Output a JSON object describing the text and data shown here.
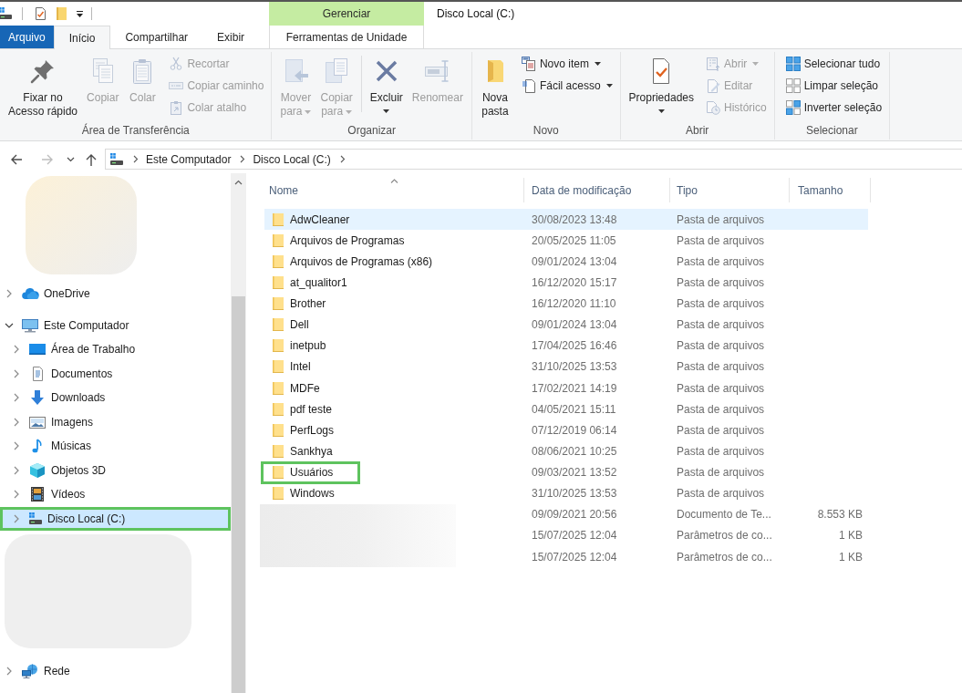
{
  "window": {
    "title": "Disco Local (C:)"
  },
  "ribbon": {
    "contextual_header": "Gerenciar",
    "tabs": [
      {
        "label": "Arquivo",
        "kind": "file",
        "selected": false
      },
      {
        "label": "Início",
        "kind": "standard",
        "selected": true
      },
      {
        "label": "Compartilhar",
        "kind": "standard",
        "selected": false
      },
      {
        "label": "Exibir",
        "kind": "standard",
        "selected": false
      },
      {
        "label": "Ferramentas de Unidade",
        "kind": "contextual",
        "selected": false
      }
    ],
    "groups": [
      {
        "label": "Área de Transferência",
        "large": [
          {
            "label": "Fixar no\nAcesso rápido",
            "disabled": false,
            "dropdown": false
          },
          {
            "label": "Copiar",
            "disabled": true,
            "dropdown": false
          },
          {
            "label": "Colar",
            "disabled": true,
            "dropdown": false
          }
        ],
        "small": [
          {
            "label": "Recortar",
            "disabled": true,
            "dropdown": false
          },
          {
            "label": "Copiar caminho",
            "disabled": true,
            "dropdown": false
          },
          {
            "label": "Colar atalho",
            "disabled": true,
            "dropdown": false
          }
        ]
      },
      {
        "label": "Organizar",
        "large": [
          {
            "label": "Mover\npara",
            "disabled": true,
            "dropdown": true
          },
          {
            "label": "Copiar\npara",
            "disabled": true,
            "dropdown": true
          },
          {
            "label": "Excluir",
            "disabled": false,
            "dropdown": true
          },
          {
            "label": "Renomear",
            "disabled": true,
            "dropdown": false
          }
        ]
      },
      {
        "label": "Novo",
        "large": [
          {
            "label": "Nova\npasta",
            "disabled": false,
            "dropdown": false
          }
        ],
        "small": [
          {
            "label": "Novo item",
            "disabled": false,
            "dropdown": true
          },
          {
            "label": "Fácil acesso",
            "disabled": false,
            "dropdown": true
          }
        ]
      },
      {
        "label": "Abrir",
        "large": [
          {
            "label": "Propriedades",
            "disabled": false,
            "dropdown": true
          }
        ],
        "small": [
          {
            "label": "Abrir",
            "disabled": true,
            "dropdown": true
          },
          {
            "label": "Editar",
            "disabled": true,
            "dropdown": false
          },
          {
            "label": "Histórico",
            "disabled": true,
            "dropdown": false
          }
        ]
      },
      {
        "label": "Selecionar",
        "small": [
          {
            "label": "Selecionar tudo",
            "disabled": false,
            "dropdown": false
          },
          {
            "label": "Limpar seleção",
            "disabled": false,
            "dropdown": false
          },
          {
            "label": "Inverter seleção",
            "disabled": false,
            "dropdown": false
          }
        ]
      }
    ]
  },
  "navigation": {
    "buttons": [
      {
        "kind": "back",
        "disabled": false
      },
      {
        "kind": "forward",
        "disabled": true
      },
      {
        "kind": "recent",
        "disabled": false
      },
      {
        "kind": "up",
        "disabled": false
      }
    ],
    "path": [
      "Este Computador",
      "Disco Local (C:)"
    ]
  },
  "nav_pane": {
    "items": [
      {
        "kind": "redacted"
      },
      {
        "kind": "node",
        "label": "OneDrive",
        "expanded": false,
        "selected": false,
        "highlighted": false
      },
      {
        "kind": "node",
        "label": "Este Computador",
        "expanded": true,
        "selected": false,
        "highlighted": false,
        "children": [
          {
            "label": "Área de Trabalho",
            "expanded": false,
            "selected": false,
            "highlighted": false
          },
          {
            "label": "Documentos",
            "expanded": false,
            "selected": false,
            "highlighted": false
          },
          {
            "label": "Downloads",
            "expanded": false,
            "selected": false,
            "highlighted": false
          },
          {
            "label": "Imagens",
            "expanded": false,
            "selected": false,
            "highlighted": false
          },
          {
            "label": "Músicas",
            "expanded": false,
            "selected": false,
            "highlighted": false
          },
          {
            "label": "Objetos 3D",
            "expanded": false,
            "selected": false,
            "highlighted": false
          },
          {
            "label": "Vídeos",
            "expanded": false,
            "selected": false,
            "highlighted": false
          },
          {
            "label": "Disco Local (C:)",
            "expanded": false,
            "selected": true,
            "highlighted": true
          }
        ]
      },
      {
        "kind": "redacted"
      },
      {
        "kind": "node",
        "label": "Rede",
        "expanded": false,
        "selected": false,
        "highlighted": false
      }
    ]
  },
  "file_list": {
    "columns": [
      {
        "label": "Nome",
        "sorted": true
      },
      {
        "label": "Data de modificação",
        "sorted": false
      },
      {
        "label": "Tipo",
        "sorted": false
      },
      {
        "label": "Tamanho",
        "sorted": false
      }
    ],
    "rows": [
      {
        "kind": "folder",
        "name": "AdwCleaner",
        "modified": "30/08/2023 13:48",
        "type": "Pasta de arquivos",
        "selected": true,
        "highlighted": false,
        "redacted": false
      },
      {
        "kind": "folder",
        "name": "Arquivos de Programas",
        "modified": "20/05/2025 11:05",
        "type": "Pasta de arquivos",
        "selected": false,
        "highlighted": false,
        "redacted": false
      },
      {
        "kind": "folder",
        "name": "Arquivos de Programas (x86)",
        "modified": "09/01/2024 13:04",
        "type": "Pasta de arquivos",
        "selected": false,
        "highlighted": false,
        "redacted": false
      },
      {
        "kind": "folder",
        "name": "at_qualitor1",
        "modified": "16/12/2020 15:17",
        "type": "Pasta de arquivos",
        "selected": false,
        "highlighted": false,
        "redacted": false
      },
      {
        "kind": "folder",
        "name": "Brother",
        "modified": "16/12/2020 11:10",
        "type": "Pasta de arquivos",
        "selected": false,
        "highlighted": false,
        "redacted": false
      },
      {
        "kind": "folder",
        "name": "Dell",
        "modified": "09/01/2024 13:04",
        "type": "Pasta de arquivos",
        "selected": false,
        "highlighted": false,
        "redacted": false
      },
      {
        "kind": "folder",
        "name": "inetpub",
        "modified": "17/04/2025 16:46",
        "type": "Pasta de arquivos",
        "selected": false,
        "highlighted": false,
        "redacted": false
      },
      {
        "kind": "folder",
        "name": "Intel",
        "modified": "31/10/2025 13:53",
        "type": "Pasta de arquivos",
        "selected": false,
        "highlighted": false,
        "redacted": false
      },
      {
        "kind": "folder",
        "name": "MDFe",
        "modified": "17/02/2021 14:19",
        "type": "Pasta de arquivos",
        "selected": false,
        "highlighted": false,
        "redacted": false
      },
      {
        "kind": "folder",
        "name": "pdf teste",
        "modified": "04/05/2021 15:11",
        "type": "Pasta de arquivos",
        "selected": false,
        "highlighted": false,
        "redacted": false
      },
      {
        "kind": "folder",
        "name": "PerfLogs",
        "modified": "07/12/2019 06:14",
        "type": "Pasta de arquivos",
        "selected": false,
        "highlighted": false,
        "redacted": false
      },
      {
        "kind": "folder",
        "name": "Sankhya",
        "modified": "08/06/2021 10:25",
        "type": "Pasta de arquivos",
        "selected": false,
        "highlighted": false,
        "redacted": false
      },
      {
        "kind": "folder",
        "name": "Usuários",
        "modified": "09/03/2021 13:52",
        "type": "Pasta de arquivos",
        "selected": false,
        "highlighted": true,
        "redacted": false
      },
      {
        "kind": "folder",
        "name": "Windows",
        "modified": "31/10/2025 13:53",
        "type": "Pasta de arquivos",
        "selected": false,
        "highlighted": false,
        "redacted": false
      },
      {
        "kind": "file",
        "modified": "09/09/2021 20:56",
        "type": "Documento de Te...",
        "size": "8.553 KB",
        "selected": false,
        "highlighted": false,
        "redacted": true
      },
      {
        "kind": "file",
        "modified": "15/07/2025 12:04",
        "type": "Parâmetros de co...",
        "size": "1 KB",
        "selected": false,
        "highlighted": false,
        "redacted": true
      },
      {
        "kind": "file",
        "modified": "15/07/2025 12:04",
        "type": "Parâmetros de co...",
        "size": "1 KB",
        "selected": false,
        "highlighted": false,
        "redacted": true
      }
    ]
  }
}
